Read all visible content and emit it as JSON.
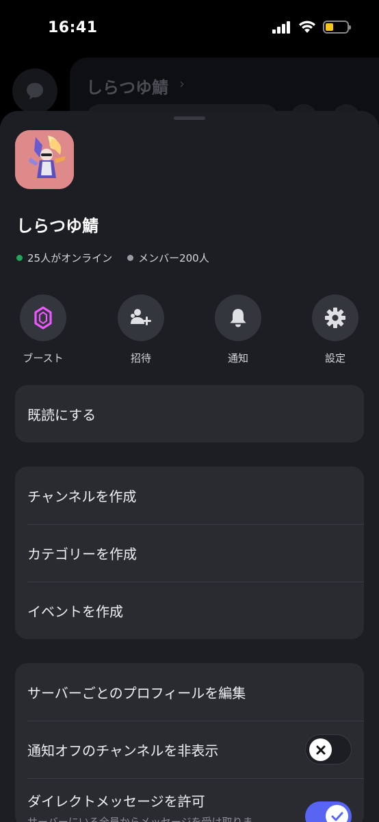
{
  "status_bar": {
    "time": "16:41",
    "icons": [
      "cellular-signal-icon",
      "wifi-icon",
      "battery-icon"
    ],
    "battery_level": 0.25
  },
  "background": {
    "server_title": "しらつゆ鯖",
    "chevron": "›"
  },
  "server": {
    "name": "しらつゆ鯖",
    "online_text": "25人がオンライン",
    "members_text": "メンバー200人"
  },
  "actions": [
    {
      "label": "ブースト",
      "icon": "boost-gem-icon"
    },
    {
      "label": "招待",
      "icon": "invite-user-plus-icon"
    },
    {
      "label": "通知",
      "icon": "bell-icon"
    },
    {
      "label": "設定",
      "icon": "gear-icon"
    }
  ],
  "menu": {
    "mark_read": "既読にする",
    "create_group": [
      "チャンネルを作成",
      "カテゴリーを作成",
      "イベントを作成"
    ],
    "edit_profile": "サーバーごとのプロフィールを編集",
    "hide_muted": {
      "label": "通知オフのチャンネルを非表示",
      "enabled": false
    },
    "allow_dm": {
      "label": "ダイレクトメッセージを許可",
      "description": "サーバーにいる全員からメッセージを受け取りま",
      "enabled": true
    }
  },
  "colors": {
    "accent": "#5865f2",
    "online": "#23a55a",
    "boost": "#eb59ff",
    "sheet_bg": "#1d1e23",
    "card_bg": "#2a2b31"
  }
}
